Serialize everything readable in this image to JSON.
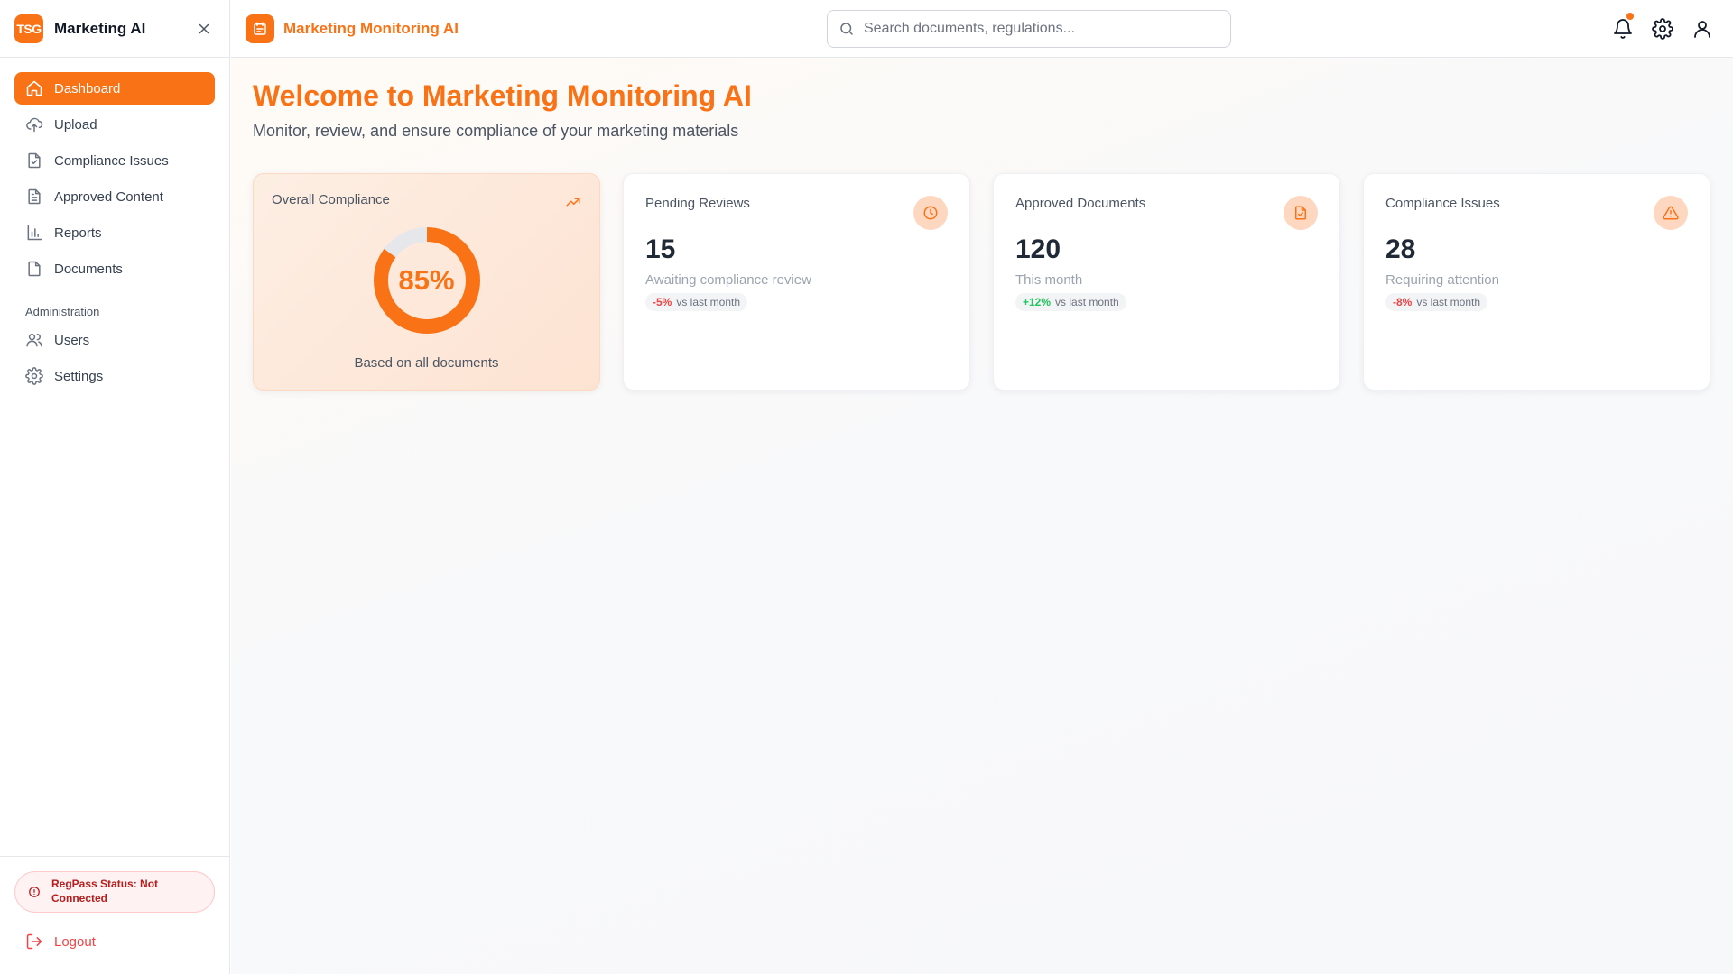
{
  "sidebar": {
    "logo_text": "TSG",
    "app_name": "Marketing AI",
    "nav": [
      {
        "label": "Dashboard",
        "icon": "home-icon",
        "active": true
      },
      {
        "label": "Upload",
        "icon": "cloud-upload-icon"
      },
      {
        "label": "Compliance Issues",
        "icon": "file-check-icon"
      },
      {
        "label": "Approved Content",
        "icon": "file-text-icon"
      },
      {
        "label": "Reports",
        "icon": "bar-chart-icon"
      },
      {
        "label": "Documents",
        "icon": "file-icon"
      }
    ],
    "admin_section": "Administration",
    "admin": [
      {
        "label": "Users",
        "icon": "users-icon"
      },
      {
        "label": "Settings",
        "icon": "gear-icon"
      }
    ],
    "regpass_status": "RegPass Status: Not Connected",
    "logout": "Logout"
  },
  "topbar": {
    "title": "Marketing Monitoring AI",
    "search_placeholder": "Search documents, regulations..."
  },
  "main": {
    "welcome": "Welcome to Marketing Monitoring AI",
    "subtitle": "Monitor, review, and ensure compliance of your marketing materials",
    "compliance_card": {
      "label": "Overall Compliance",
      "value": "85%",
      "percent": 85,
      "caption": "Based on all documents"
    },
    "stats": [
      {
        "label": "Pending Reviews",
        "value": "15",
        "sub": "Awaiting compliance review",
        "change": "-5%",
        "change_type": "neg",
        "vs": "vs last month",
        "icon": "clock-icon"
      },
      {
        "label": "Approved Documents",
        "value": "120",
        "sub": "This month",
        "change": "+12%",
        "change_type": "pos",
        "vs": "vs last month",
        "icon": "file-check-icon"
      },
      {
        "label": "Compliance Issues",
        "value": "28",
        "sub": "Requiring attention",
        "change": "-8%",
        "change_type": "neg",
        "vs": "vs last month",
        "icon": "alert-triangle-icon"
      }
    ]
  },
  "colors": {
    "accent": "#f97316",
    "danger": "#ef4444",
    "success": "#22c55e"
  }
}
